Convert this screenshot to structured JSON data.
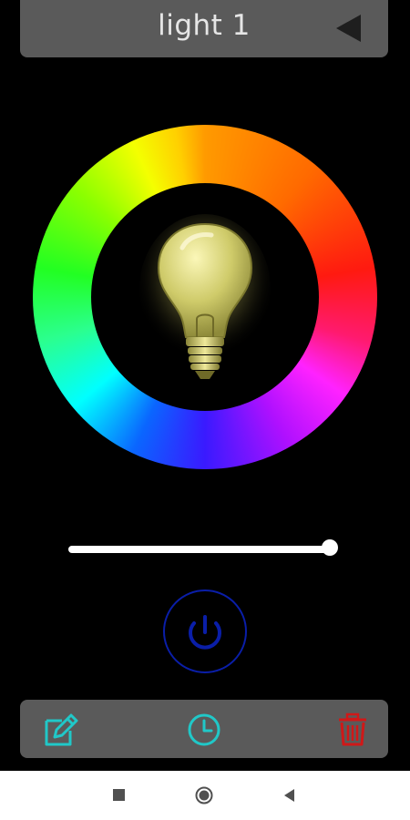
{
  "header": {
    "title": "light 1",
    "back_icon": "back-triangle-icon"
  },
  "light": {
    "wheel_icon": "color-wheel",
    "bulb_icon": "light-bulb-icon",
    "brightness": 0.97,
    "power_icon": "power-icon"
  },
  "toolbar": {
    "edit_icon": "edit-icon",
    "schedule_icon": "clock-icon",
    "delete_icon": "trash-icon"
  },
  "navbar": {
    "recents_icon": "square-icon",
    "home_icon": "circle-icon",
    "back_icon": "triangle-back-icon"
  },
  "colors": {
    "header_bg": "#5a5a5a",
    "title_text": "#e6e6e6",
    "power_ring": "#0a1ea8",
    "toolbar_icon": "#20c8c8",
    "delete_icon": "#d01818",
    "bulb": "#d8d67a"
  }
}
